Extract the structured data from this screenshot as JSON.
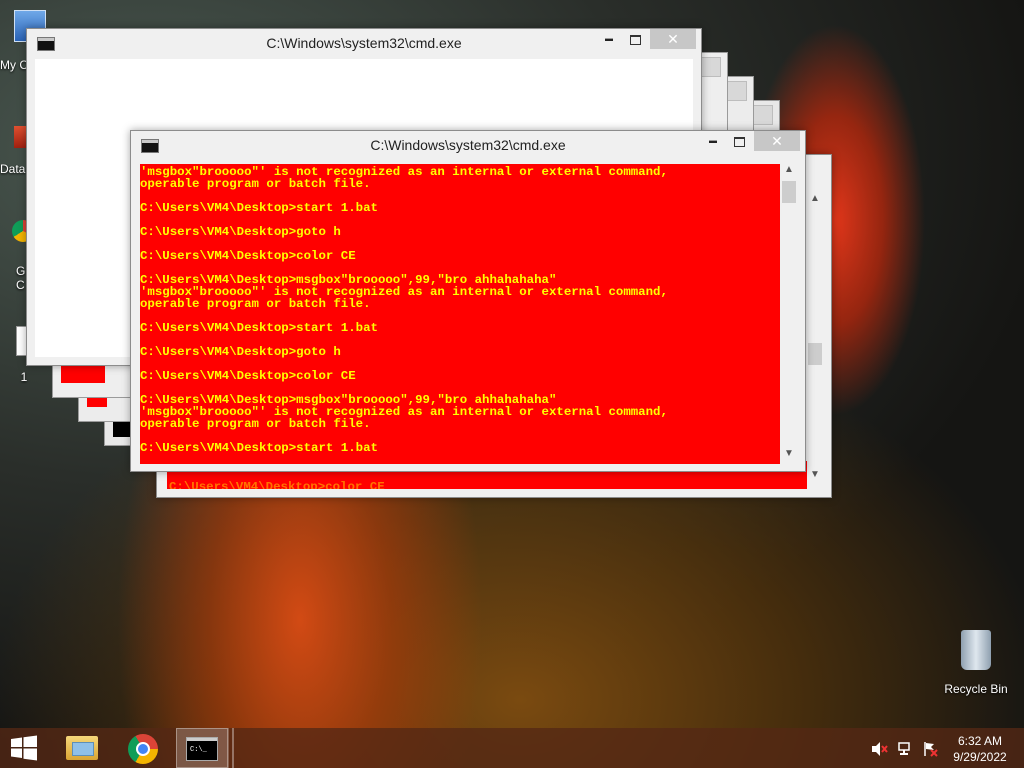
{
  "desktop": {
    "icons": [
      {
        "name": "My C",
        "id": "computer"
      },
      {
        "name": "Data",
        "id": "data"
      },
      {
        "name": "G C",
        "id": "chrome"
      },
      {
        "name": "1",
        "id": "file-1"
      },
      {
        "name": "Recycle Bin",
        "id": "recycle-bin"
      }
    ]
  },
  "back_window": {
    "title": "C:\\Windows\\system32\\cmd.exe",
    "close": "✕",
    "minimize": "▬"
  },
  "front_window": {
    "title": "C:\\Windows\\system32\\cmd.exe",
    "close": "✕",
    "minimize": "▬"
  },
  "console_lines": [
    "'msgbox\"brooooo\"' is not recognized as an internal or external command,",
    "operable program or batch file.",
    "",
    "C:\\Users\\VM4\\Desktop>start 1.bat",
    "",
    "C:\\Users\\VM4\\Desktop>goto h",
    "",
    "C:\\Users\\VM4\\Desktop>color CE",
    "",
    "C:\\Users\\VM4\\Desktop>msgbox\"brooooo\",99,\"bro ahhahahaha\"",
    "'msgbox\"brooooo\"' is not recognized as an internal or external command,",
    "operable program or batch file.",
    "",
    "C:\\Users\\VM4\\Desktop>start 1.bat",
    "",
    "C:\\Users\\VM4\\Desktop>goto h",
    "",
    "C:\\Users\\VM4\\Desktop>color CE",
    "",
    "C:\\Users\\VM4\\Desktop>msgbox\"brooooo\",99,\"bro ahhahahaha\"",
    "'msgbox\"brooooo\"' is not recognized as an internal or external command,",
    "operable program or batch file.",
    "",
    "C:\\Users\\VM4\\Desktop>start 1.bat"
  ],
  "behind_console_line": "C:\\Users\\VM4\\Desktop>color CE",
  "taskbar": {
    "time": "6:32 AM",
    "date": "9/29/2022",
    "items": [
      "start-button",
      "file-explorer",
      "chrome",
      "cmd"
    ]
  },
  "colors": {
    "console_bg": "#ff0000",
    "console_fg": "#ffff00",
    "taskbar": "#55281a"
  }
}
